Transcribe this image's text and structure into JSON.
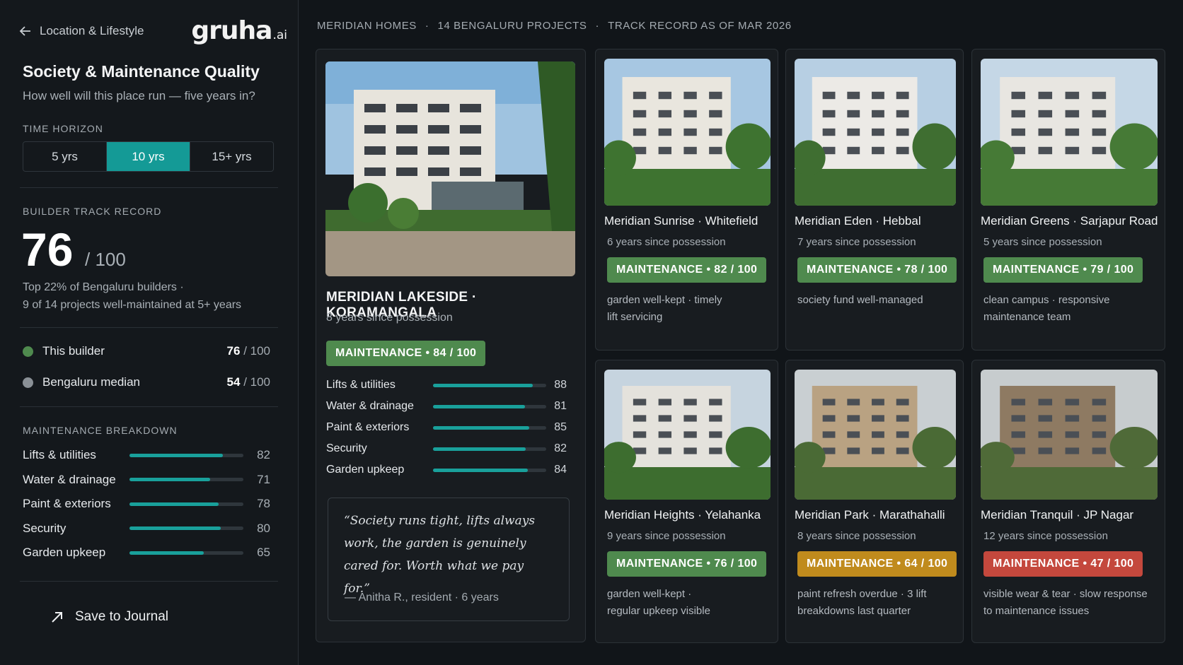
{
  "nav": {
    "back_label": "Location & Lifestyle",
    "logo_main": "gruha",
    "logo_suffix": ".ai"
  },
  "sidebar": {
    "title": "Society & Maintenance Quality",
    "subtitle": "How well will this place run — five years in?",
    "time_horizon_label": "TIME HORIZON",
    "time_horizon_options": [
      "5 yrs",
      "10 yrs",
      "15+ yrs"
    ],
    "time_horizon_selected": "10 yrs",
    "track_record_label": "BUILDER TRACK RECORD",
    "score": "76",
    "score_denominator": "/ 100",
    "rank_line": "Top 22% of Bengaluru builders ·",
    "projects_line": "9 of 14 projects well-maintained at 5+ years",
    "comparison": [
      {
        "label": "This builder",
        "value": "76",
        "suffix": "/ 100",
        "color": "#4f8a4e"
      },
      {
        "label": "Bengaluru median",
        "value": "54",
        "suffix": "/ 100",
        "color": "#8a9096"
      }
    ],
    "breakdown_label": "MAINTENANCE BREAKDOWN",
    "breakdown": [
      {
        "label": "Lifts & utilities",
        "value": 82
      },
      {
        "label": "Water & drainage",
        "value": 71
      },
      {
        "label": "Paint & exteriors",
        "value": 78
      },
      {
        "label": "Security",
        "value": 80
      },
      {
        "label": "Garden upkeep",
        "value": 65
      }
    ],
    "save_label": "Save to Journal"
  },
  "header": {
    "builder": "MERIDIAN HOMES",
    "projects": "14 BENGALURU PROJECTS",
    "as_of": "TRACK RECORD AS OF MAR 2026",
    "separator": "·"
  },
  "featured": {
    "title": "MERIDIAN LAKESIDE · KORAMANGALA",
    "subtitle": "8 years since possession",
    "badge": "MAINTENANCE  •  84 / 100",
    "breakdown": [
      {
        "label": "Lifts & utilities",
        "value": 88
      },
      {
        "label": "Water & drainage",
        "value": 81
      },
      {
        "label": "Paint & exteriors",
        "value": 85
      },
      {
        "label": "Security",
        "value": 82
      },
      {
        "label": "Garden upkeep",
        "value": 84
      }
    ],
    "quote": "“Society runs tight, lifts always work, the garden is genuinely cared for. Worth what we pay for.”",
    "quote_by": "— Anitha R., resident · 6 years"
  },
  "projects": [
    {
      "name": "Meridian Sunrise · Whitefield",
      "possession": "6 years since possession",
      "badge": "MAINTENANCE  •  82 / 100",
      "tone": "g",
      "note": [
        "garden well-kept · timely",
        "lift servicing"
      ]
    },
    {
      "name": "Meridian Eden · Hebbal",
      "possession": "7 years since possession",
      "badge": "MAINTENANCE  •  78 / 100",
      "tone": "g",
      "note": [
        "society fund well-managed",
        ""
      ]
    },
    {
      "name": "Meridian Greens · Sarjapur Road",
      "possession": "5 years since possession",
      "badge": "MAINTENANCE  •  79 / 100",
      "tone": "g",
      "note": [
        "clean campus · responsive",
        "maintenance team"
      ]
    },
    {
      "name": "Meridian Heights · Yelahanka",
      "possession": "9 years since possession",
      "badge": "MAINTENANCE  •  76 / 100",
      "tone": "g",
      "note": [
        "garden well-kept ·",
        "regular upkeep visible"
      ]
    },
    {
      "name": "Meridian Park · Marathahalli",
      "possession": "8 years since possession",
      "badge": "MAINTENANCE  •  64 / 100",
      "tone": "y",
      "note": [
        "paint refresh overdue · 3 lift",
        "breakdowns last quarter"
      ]
    },
    {
      "name": "Meridian Tranquil · JP Nagar",
      "possession": "12 years since possession",
      "badge": "MAINTENANCE  •  47 / 100",
      "tone": "r",
      "note": [
        "visible wear & tear · slow response",
        "to maintenance issues"
      ]
    }
  ],
  "colors": {
    "accent": "#149a96",
    "bar": "#19a09b",
    "good": "#4f8a4e",
    "warn": "#c08b1d",
    "bad": "#c4483d"
  }
}
